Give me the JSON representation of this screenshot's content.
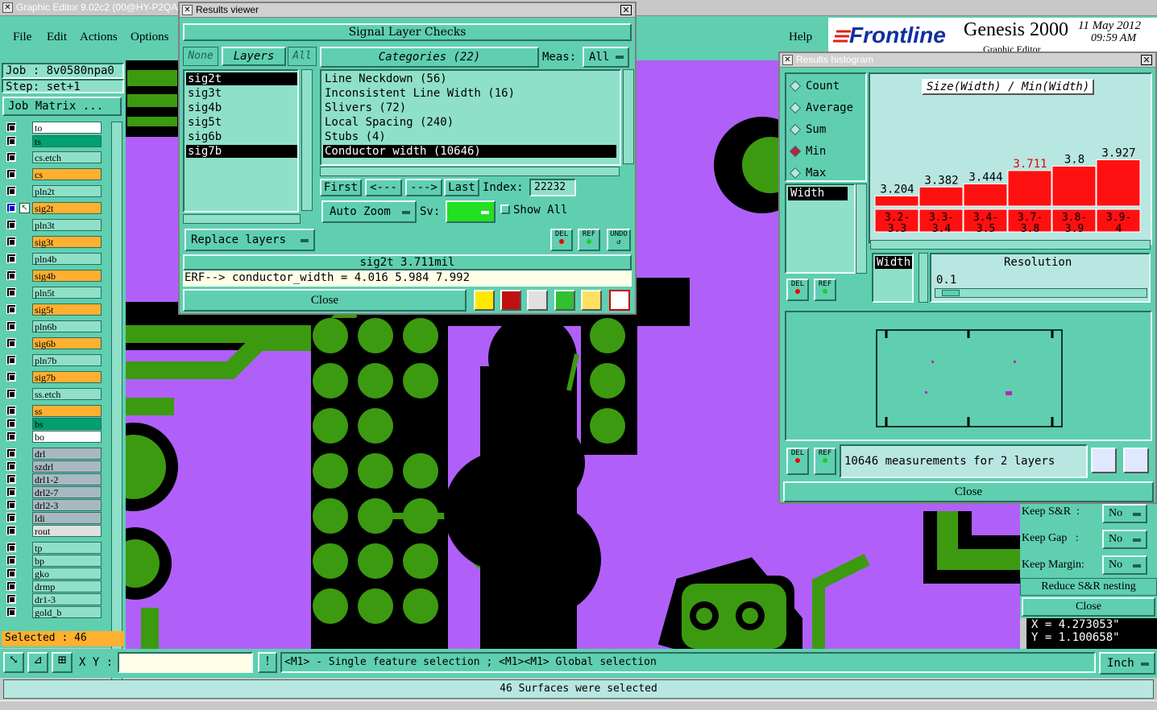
{
  "app": {
    "title": "Graphic Editor 9.02c2 (00@HY-P2QA",
    "menu": [
      "File",
      "Edit",
      "Actions",
      "Options"
    ],
    "help": "Help",
    "brand": "Frontline",
    "product": "Genesis 2000",
    "product_sub": "Graphic Editor",
    "date": "11 May 2012",
    "time": "09:59 AM"
  },
  "job": {
    "job_label": "Job : 8v0580npa0",
    "step_label": "Step: set+1",
    "matrix_button": "Job Matrix ..."
  },
  "layers": [
    {
      "name": "to",
      "color": "#ffffff"
    },
    {
      "name": "ts",
      "color": "#00a070"
    },
    {
      "name": "cs.etch",
      "color": "#8fe0c8"
    },
    {
      "name": "cs",
      "color": "#ffb030"
    },
    {
      "name": "pln2t",
      "color": "#8fe0c8"
    },
    {
      "name": "sig2t",
      "color": "#ffb030",
      "active": true
    },
    {
      "name": "pln3t",
      "color": "#8fe0c8"
    },
    {
      "name": "sig3t",
      "color": "#ffb030"
    },
    {
      "name": "pln4b",
      "color": "#8fe0c8"
    },
    {
      "name": "sig4b",
      "color": "#ffb030"
    },
    {
      "name": "pln5t",
      "color": "#8fe0c8"
    },
    {
      "name": "sig5t",
      "color": "#ffb030"
    },
    {
      "name": "pln6b",
      "color": "#8fe0c8"
    },
    {
      "name": "sig6b",
      "color": "#ffb030"
    },
    {
      "name": "pln7b",
      "color": "#8fe0c8"
    },
    {
      "name": "sig7b",
      "color": "#ffb030"
    },
    {
      "name": "ss.etch",
      "color": "#8fe0c8"
    },
    {
      "name": "ss",
      "color": "#ffb030"
    },
    {
      "name": "bs",
      "color": "#00a070"
    },
    {
      "name": "bo",
      "color": "#ffffff"
    },
    {
      "name": "drl",
      "color": "#a8b8c0"
    },
    {
      "name": "szdrl",
      "color": "#a8b8c0"
    },
    {
      "name": "drl1-2",
      "color": "#a8b8c0"
    },
    {
      "name": "drl2-7",
      "color": "#a8b8c0"
    },
    {
      "name": "drl2-3",
      "color": "#a8b8c0"
    },
    {
      "name": "ldi",
      "color": "#a8b8c0"
    },
    {
      "name": "rout",
      "color": "#e0e0e0"
    },
    {
      "name": "tp",
      "color": "#8fe0c8"
    },
    {
      "name": "bp",
      "color": "#8fe0c8"
    },
    {
      "name": "gko",
      "color": "#8fe0c8"
    },
    {
      "name": "drmp",
      "color": "#8fe0c8"
    },
    {
      "name": "dr1-3",
      "color": "#8fe0c8"
    },
    {
      "name": "gold_b",
      "color": "#8fe0c8"
    }
  ],
  "selected_label": "Selected : 46",
  "results_viewer": {
    "title": "Results viewer",
    "header": "Signal Layer Checks",
    "none": "None",
    "layers_btn": "Layers",
    "all": "All",
    "categories_btn": "Categories (22)",
    "meas_label": "Meas:",
    "meas_value": "All",
    "layer_list": [
      "sig2t",
      "sig3t",
      "sig4b",
      "sig5t",
      "sig6b",
      "sig7b"
    ],
    "category_list": [
      "Line Neckdown (56)",
      "Inconsistent Line Width (16)",
      "Slivers (72)",
      "Local Spacing (240)",
      "Stubs (4)",
      "Conductor width (10646)"
    ],
    "first": "First",
    "prev": "<---",
    "next": "--->",
    "last": "Last",
    "index_label": "Index:",
    "index_value": "22232",
    "auto_zoom": "Auto Zoom",
    "sv_label": "Sv:",
    "show_all": "Show All",
    "replace_layers": "Replace layers",
    "del": "DEL",
    "ref": "REF",
    "undo": "UNDO",
    "status": "sig2t 3.711mil",
    "erf": "ERF--> conductor_width = 4.016 5.984 7.992",
    "close": "Close"
  },
  "histogram": {
    "title": "Results histogram",
    "options": [
      "Count",
      "Average",
      "Sum",
      "Min",
      "Max"
    ],
    "selected_option": "Min",
    "chart_title": "Size(Width) / Min(Width)",
    "width_item": "Width",
    "width_box": "Width",
    "resolution_label": "Resolution",
    "resolution_value": "0.1",
    "del": "DEL",
    "ref": "REF",
    "summary": "10646 measurements for 2 layers",
    "close": "Close"
  },
  "chart_data": {
    "type": "bar",
    "title": "Size(Width) / Min(Width)",
    "categories": [
      "3.2-3.3",
      "3.3-3.4",
      "3.4-3.5",
      "3.7-3.8",
      "3.8-3.9",
      "3.9-4"
    ],
    "values": [
      3.204,
      3.382,
      3.444,
      3.711,
      3.8,
      3.927
    ],
    "value_labels": [
      "3.204",
      "3.382",
      "3.444",
      "3.711",
      "3.8",
      "3.927"
    ],
    "highlight_index": 3,
    "bar_color": "#ff1010",
    "highlight_label_color": "#e00000"
  },
  "keep_panel": {
    "keep_sr": "Keep S&R  :",
    "keep_gap": "Keep Gap   :",
    "keep_margin": "Keep Margin:",
    "no": "No",
    "reduce": "Reduce S&R nesting",
    "close": "Close"
  },
  "coords": {
    "x": "X = 4.273053\"",
    "y": "Y = 1.100658\""
  },
  "bottom": {
    "xy_label": "X Y :",
    "xy_value": "",
    "hint": "<M1> - Single feature selection ; <M1><M1> Global selection",
    "units": "Inch",
    "status": "46 Surfaces were selected"
  },
  "colors": {
    "canvas": "#b060f8",
    "copper": "#3c9a10",
    "black": "#000000",
    "teal": "#5fcfb0"
  }
}
